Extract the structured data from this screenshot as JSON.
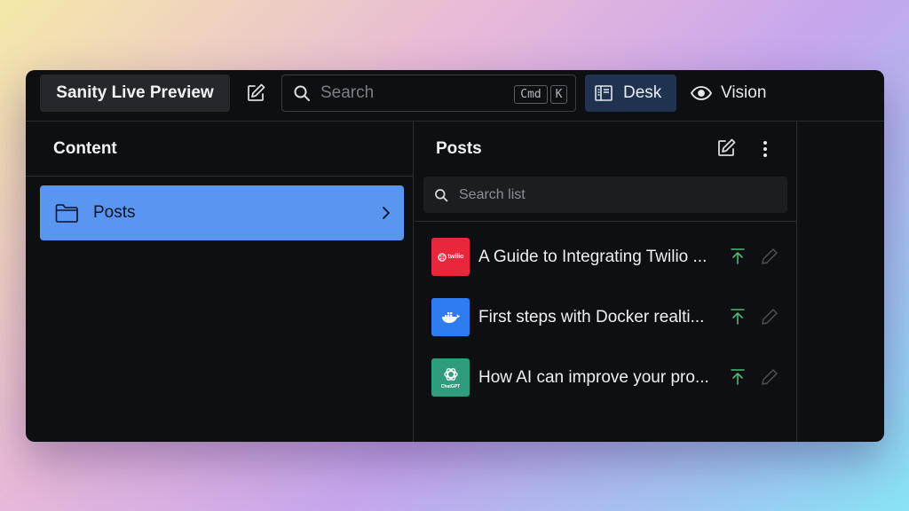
{
  "app": {
    "title": "Sanity Live Preview"
  },
  "search": {
    "placeholder": "Search",
    "shortcut_keys": [
      "Cmd",
      "K"
    ]
  },
  "tools": [
    {
      "label": "Desk",
      "icon": "desk-icon",
      "active": true
    },
    {
      "label": "Vision",
      "icon": "eye-icon",
      "active": false
    }
  ],
  "content_pane": {
    "title": "Content",
    "items": [
      {
        "label": "Posts",
        "icon": "folder-icon",
        "selected": true
      }
    ]
  },
  "posts_pane": {
    "title": "Posts",
    "search_placeholder": "Search list",
    "documents": [
      {
        "title": "A Guide to Integrating Twilio ...",
        "thumb": "twilio-logo",
        "thumb_text": "twilio",
        "thumb_color": "#e8273a"
      },
      {
        "title": "First steps with Docker realti...",
        "thumb": "docker-logo",
        "thumb_text": "",
        "thumb_color": "#2f7cf0"
      },
      {
        "title": "How AI can improve your pro...",
        "thumb": "chatgpt-logo",
        "thumb_text": "ChatGPT",
        "thumb_color": "#2f9c7d"
      }
    ]
  },
  "colors": {
    "accent": "#5b95f2",
    "active_tool_bg": "#1f3350",
    "publish_icon": "#4fb876",
    "window_bg": "#0e0f12"
  }
}
